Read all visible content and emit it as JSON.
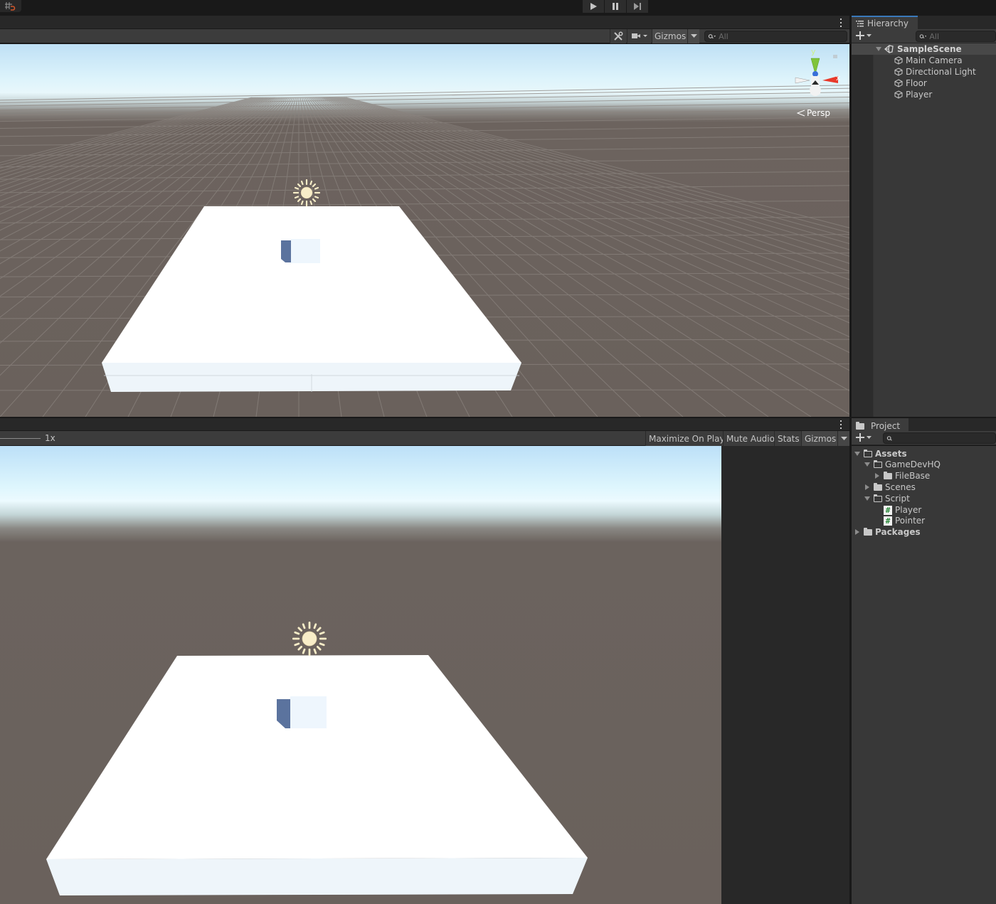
{
  "toolbar": {
    "play_icon": "play-icon",
    "pause_icon": "pause-icon",
    "step_icon": "step-icon",
    "snap_icon": "grid-snap-icon"
  },
  "scene_view": {
    "toolbar": {
      "tools_icon": "tools-icon",
      "camera_icon": "camera-icon",
      "gizmos_label": "Gizmos",
      "search_placeholder": "All",
      "search_value": ""
    },
    "gizmo": {
      "y_label": "y",
      "x_label": "x",
      "projection_label": "Persp"
    }
  },
  "game_view": {
    "scale_label": "1x",
    "buttons": {
      "maximize_on_play": "Maximize On Play",
      "mute_audio": "Mute Audio",
      "stats": "Stats",
      "gizmos": "Gizmos"
    }
  },
  "hierarchy": {
    "tab_label": "Hierarchy",
    "search_placeholder": "All",
    "search_value": "",
    "scene_name": "SampleScene",
    "objects": [
      {
        "label": "Main Camera"
      },
      {
        "label": "Directional Light"
      },
      {
        "label": "Floor"
      },
      {
        "label": "Player"
      }
    ]
  },
  "project": {
    "tab_label": "Project",
    "search_placeholder": "",
    "search_value": "",
    "tree": {
      "assets": "Assets",
      "gamedevhq": "GameDevHQ",
      "filebase": "FileBase",
      "scenes": "Scenes",
      "script": "Script",
      "player_script": "Player",
      "pointer_script": "Pointer",
      "packages": "Packages"
    }
  },
  "colors": {
    "accent_tab": "#3a79bb",
    "axis_x": "#e8392a",
    "axis_y": "#7fc43a",
    "axis_z": "#3a6fd8",
    "sun": "#f8edc8",
    "player_dark": "#5b739e",
    "player_light": "#eef6fd"
  }
}
